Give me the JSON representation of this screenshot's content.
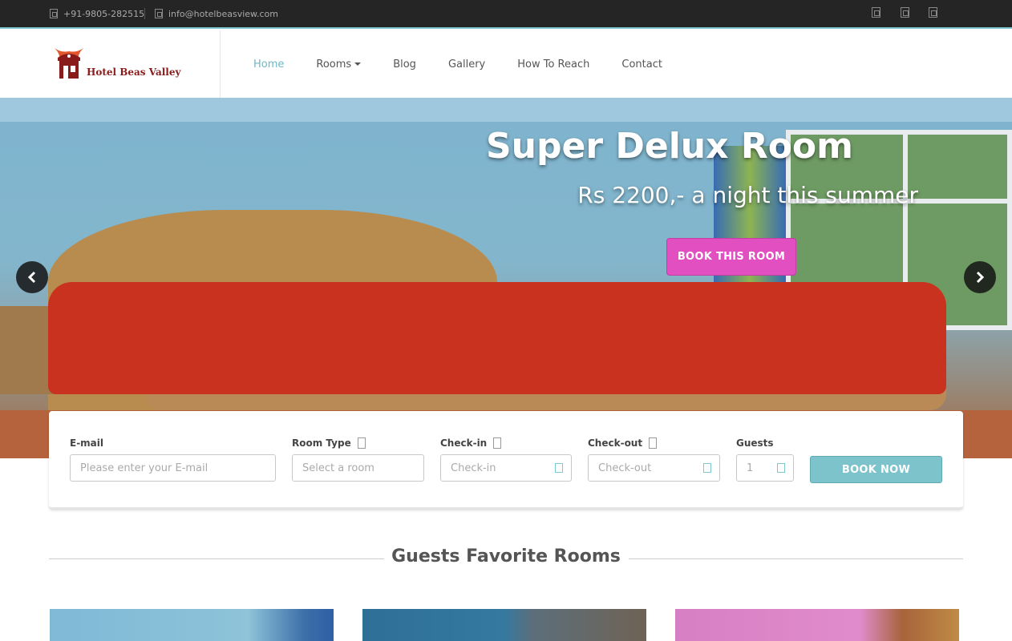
{
  "topbar": {
    "phone": "+91-9805-282515",
    "email": "info@hotelbeasview.com",
    "social_icons": [
      "facebook-icon",
      "twitter-icon",
      "google-plus-icon"
    ]
  },
  "header": {
    "logo_text": "Hotel Beas Valley",
    "nav": {
      "home": "Home",
      "rooms": "Rooms",
      "blog": "Blog",
      "gallery": "Gallery",
      "how_to_reach": "How To Reach",
      "contact": "Contact"
    }
  },
  "hero": {
    "title": "Super Delux Room",
    "subtitle": "Rs 2200,- a night this summer",
    "button": "BOOK THIS ROOM"
  },
  "booking": {
    "email_label": "E-mail",
    "email_placeholder": "Please enter your E-mail",
    "room_label": "Room Type",
    "room_placeholder": "Select a room",
    "checkin_label": "Check-in",
    "checkin_placeholder": "Check-in",
    "checkout_label": "Check-out",
    "checkout_placeholder": "Check-out",
    "guests_label": "Guests",
    "guests_value": "1",
    "button": "BOOK NOW"
  },
  "section": {
    "title": "Guests Favorite Rooms"
  },
  "colors": {
    "accent": "#7dc3cc",
    "hero_button": "#e24fc0",
    "topbar": "#252525"
  }
}
